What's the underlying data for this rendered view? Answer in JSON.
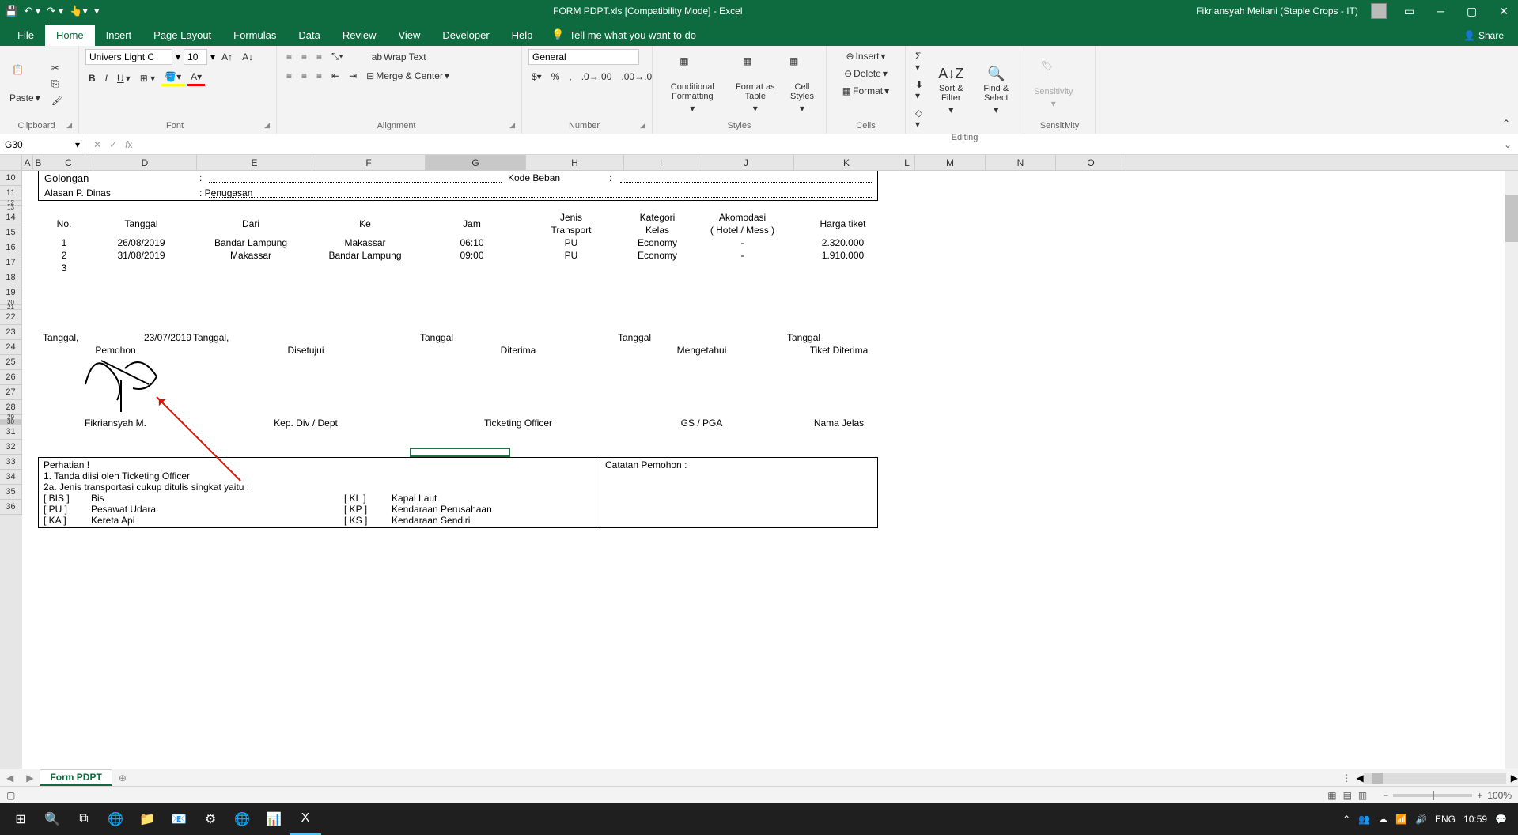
{
  "titlebar": {
    "title": "FORM PDPT.xls  [Compatibility Mode]  -  Excel",
    "user": "Fikriansyah Meilani (Staple Crops - IT)"
  },
  "tabs": {
    "file": "File",
    "items": [
      "Home",
      "Insert",
      "Page Layout",
      "Formulas",
      "Data",
      "Review",
      "View",
      "Developer",
      "Help"
    ],
    "tell": "Tell me what you want to do",
    "share": "Share"
  },
  "ribbon": {
    "clipboard": {
      "label": "Clipboard",
      "paste": "Paste"
    },
    "font": {
      "label": "Font",
      "name": "Univers Light C",
      "size": "10"
    },
    "alignment": {
      "label": "Alignment",
      "wrap": "Wrap Text",
      "merge": "Merge & Center"
    },
    "number": {
      "label": "Number",
      "format": "General"
    },
    "styles": {
      "label": "Styles",
      "cond": "Conditional Formatting",
      "fmt": "Format as Table",
      "cell": "Cell Styles"
    },
    "cells": {
      "label": "Cells",
      "insert": "Insert",
      "delete": "Delete",
      "format": "Format"
    },
    "editing": {
      "label": "Editing",
      "sort": "Sort & Filter",
      "find": "Find & Select"
    },
    "sens": {
      "label": "Sensitivity",
      "btn": "Sensitivity"
    }
  },
  "fbar": {
    "name": "G30",
    "fx": ""
  },
  "cols": {
    "A": 14,
    "B": 14,
    "C": 62,
    "D": 131,
    "E": 146,
    "F": 143,
    "G": 127,
    "H": 124,
    "I": 94,
    "J": 121,
    "K": 133,
    "L": 20,
    "M": 89,
    "N": 89,
    "O": 89
  },
  "rows": {
    "r10": {
      "c": "Golongan",
      "d": ":",
      "h": "Kode Beban",
      "i": ":"
    },
    "r11": {
      "c": "Alasan P. Dinas",
      "d": ": Penugasan"
    }
  },
  "table_header": {
    "no": "No.",
    "tanggal": "Tanggal",
    "dari": "Dari",
    "ke": "Ke",
    "jam": "Jam",
    "jenis1": "Jenis",
    "jenis2": "Transport",
    "kat1": "Kategori",
    "kat2": "Kelas",
    "ako1": "Akomodasi",
    "ako2": "( Hotel / Mess )",
    "harga": "Harga tiket"
  },
  "table_rows": [
    {
      "no": "1",
      "tanggal": "26/08/2019",
      "dari": "Bandar Lampung",
      "ke": "Makassar",
      "jam": "06:10",
      "jenis": "PU",
      "kat": "Economy",
      "ako": "-",
      "harga": "2.320.000"
    },
    {
      "no": "2",
      "tanggal": "31/08/2019",
      "dari": "Makassar",
      "ke": "Bandar Lampung",
      "jam": "09:00",
      "jenis": "PU",
      "kat": "Economy",
      "ako": "-",
      "harga": "1.910.000"
    },
    {
      "no": "3",
      "tanggal": "",
      "dari": "",
      "ke": "",
      "jam": "",
      "jenis": "",
      "kat": "",
      "ako": "",
      "harga": ""
    }
  ],
  "sig_block": {
    "col1": {
      "line1a": "Tanggal,",
      "line1b": "23/07/2019",
      "line2": "Pemohon",
      "name": "Fikriansyah M."
    },
    "col2": {
      "line1": "Tanggal,",
      "line2": "Disetujui",
      "name": "Kep. Div / Dept"
    },
    "col3": {
      "line1": "Tanggal",
      "line2": "Diterima",
      "name": "Ticketing Officer"
    },
    "col4": {
      "line1": "Tanggal",
      "line2": "Mengetahui",
      "name": "GS / PGA"
    },
    "col5": {
      "line1": "Tanggal",
      "line2": "Tiket Diterima",
      "name": "Nama Jelas"
    }
  },
  "notes": {
    "title": "Perhatian !",
    "l1": "1. Tanda  diisi oleh Ticketing Officer",
    "l2": "2a. Jenis transportasi cukup ditulis singkat yaitu :",
    "bis_code": "[ BIS ]",
    "bis": "Bis",
    "pu_code": "[ PU ]",
    "pu": "Pesawat Udara",
    "ka_code": "[ KA ]",
    "ka": "Kereta Api",
    "kl_code": "[ KL ]",
    "kl": "Kapal Laut",
    "kp_code": "[ KP ]",
    "kp": "Kendaraan Perusahaan",
    "ks_code": "[ KS ]",
    "ks": "Kendaraan Sendiri",
    "catatan": "Catatan Pemohon :"
  },
  "sheettab": "Form PDPT",
  "status": {
    "zoom": "100%"
  },
  "taskbar": {
    "time": "10:59"
  }
}
